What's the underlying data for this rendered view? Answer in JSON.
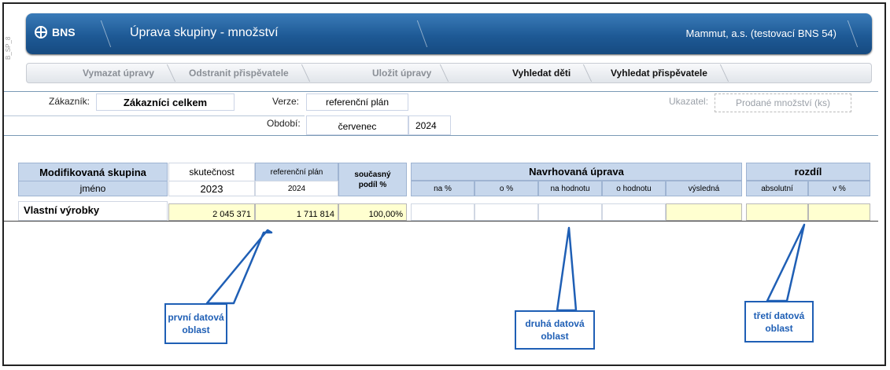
{
  "side_label": "B_SP_8",
  "header": {
    "logo": "BNS",
    "title": "Úprava skupiny - množství",
    "company": "Mammut, a.s. (testovací BNS 54)"
  },
  "toolbar": {
    "clear": "Vymazat úpravy",
    "remove": "Odstranit přispěvatele",
    "save": "Uložit úpravy",
    "find_children": "Vyhledat děti",
    "find_contrib": "Vyhledat přispěvatele"
  },
  "filters": {
    "customer_label": "Zákazník:",
    "customer_value": "Zákazníci celkem",
    "version_label": "Verze:",
    "version_value": "referenční plán",
    "period_label": "Období:",
    "month": "červenec",
    "year": "2024",
    "indicator_label": "Ukazatel:",
    "indicator_value": "Prodané množství (ks)"
  },
  "grid": {
    "group_header": "Modifikovaná skupina",
    "name_header": "jméno",
    "actual_header": "skutečnost",
    "actual_year": "2023",
    "ref_header": "referenční plán",
    "ref_year": "2024",
    "share_header": "současný podíl %",
    "proposed_header": "Navrhovaná úprava",
    "proposed_cols": [
      "na %",
      "o %",
      "na hodnotu",
      "o hodnotu",
      "výsledná"
    ],
    "diff_header": "rozdíl",
    "diff_cols": [
      "absolutní",
      "v %"
    ],
    "row": {
      "name": "Vlastní výrobky",
      "actual": "2 045 371",
      "ref": "1 711 814",
      "share": "100,00%"
    }
  },
  "callouts": {
    "first": "první datová oblast",
    "second": "druhá datová oblast",
    "third": "třetí datová oblast"
  },
  "colors": {
    "header_blue": "#1e5a96",
    "grid_header": "#c7d7ec",
    "data_yellow": "#ffffd0",
    "callout_blue": "#1f5fb5"
  }
}
